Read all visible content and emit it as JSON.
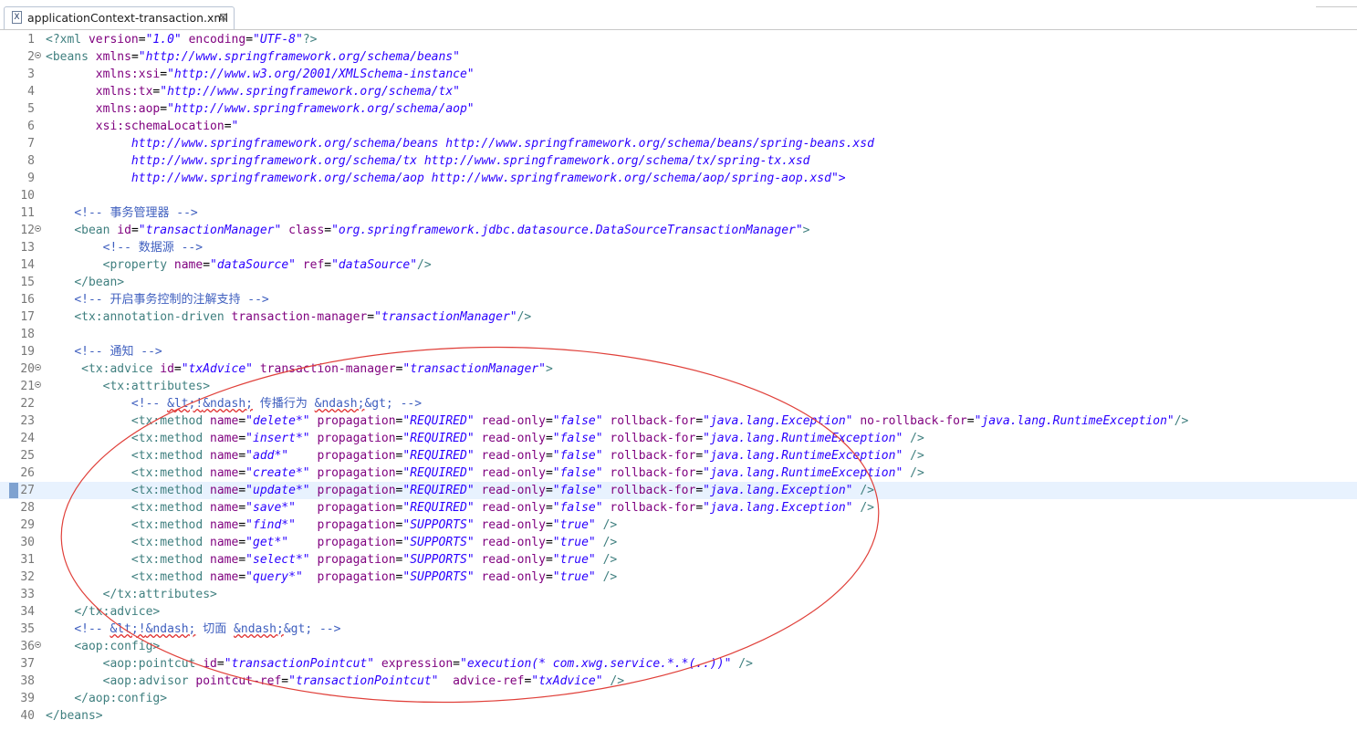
{
  "tab": {
    "icon": "xml-file-icon",
    "icon_glyph": "X",
    "title": "applicationContext-transaction.xml",
    "close_glyph": "⊠"
  },
  "editor": {
    "current_line": 27,
    "lines": [
      {
        "n": "1",
        "code": "<?xml version=\"1.0\" encoding=\"UTF-8\"?>"
      },
      {
        "n": "2",
        "code": "<beans xmlns=\"http://www.springframework.org/schema/beans\"",
        "fold": true
      },
      {
        "n": "3",
        "code": "       xmlns:xsi=\"http://www.w3.org/2001/XMLSchema-instance\""
      },
      {
        "n": "4",
        "code": "       xmlns:tx=\"http://www.springframework.org/schema/tx\""
      },
      {
        "n": "5",
        "code": "       xmlns:aop=\"http://www.springframework.org/schema/aop\""
      },
      {
        "n": "6",
        "code": "       xsi:schemaLocation=\""
      },
      {
        "n": "7",
        "code": "            http://www.springframework.org/schema/beans http://www.springframework.org/schema/beans/spring-beans.xsd"
      },
      {
        "n": "8",
        "code": "            http://www.springframework.org/schema/tx http://www.springframework.org/schema/tx/spring-tx.xsd"
      },
      {
        "n": "9",
        "code": "            http://www.springframework.org/schema/aop http://www.springframework.org/schema/aop/spring-aop.xsd\">"
      },
      {
        "n": "10",
        "code": ""
      },
      {
        "n": "11",
        "code": "    <!-- 事务管理器 -->"
      },
      {
        "n": "12",
        "code": "    <bean id=\"transactionManager\" class=\"org.springframework.jdbc.datasource.DataSourceTransactionManager\">",
        "fold": true
      },
      {
        "n": "13",
        "code": "        <!-- 数据源 -->"
      },
      {
        "n": "14",
        "code": "        <property name=\"dataSource\" ref=\"dataSource\"/>"
      },
      {
        "n": "15",
        "code": "    </bean>"
      },
      {
        "n": "16",
        "code": "    <!-- 开启事务控制的注解支持 -->"
      },
      {
        "n": "17",
        "code": "    <tx:annotation-driven transaction-manager=\"transactionManager\"/>"
      },
      {
        "n": "18",
        "code": ""
      },
      {
        "n": "19",
        "code": "    <!-- 通知 -->"
      },
      {
        "n": "20",
        "code": "     <tx:advice id=\"txAdvice\" transaction-manager=\"transactionManager\">",
        "fold": true
      },
      {
        "n": "21",
        "code": "        <tx:attributes>",
        "fold": true
      },
      {
        "n": "22",
        "code": "            <!-- &lt;!&ndash; 传播行为 &ndash;&gt; -->"
      },
      {
        "n": "23",
        "code": "            <tx:method name=\"delete*\" propagation=\"REQUIRED\" read-only=\"false\" rollback-for=\"java.lang.Exception\" no-rollback-for=\"java.lang.RuntimeException\"/>"
      },
      {
        "n": "24",
        "code": "            <tx:method name=\"insert*\" propagation=\"REQUIRED\" read-only=\"false\" rollback-for=\"java.lang.RuntimeException\" />"
      },
      {
        "n": "25",
        "code": "            <tx:method name=\"add*\"    propagation=\"REQUIRED\" read-only=\"false\" rollback-for=\"java.lang.RuntimeException\" />"
      },
      {
        "n": "26",
        "code": "            <tx:method name=\"create*\" propagation=\"REQUIRED\" read-only=\"false\" rollback-for=\"java.lang.RuntimeException\" />"
      },
      {
        "n": "27",
        "code": "            <tx:method name=\"update*\" propagation=\"REQUIRED\" read-only=\"false\" rollback-for=\"java.lang.Exception\" />"
      },
      {
        "n": "28",
        "code": "            <tx:method name=\"save*\"   propagation=\"REQUIRED\" read-only=\"false\" rollback-for=\"java.lang.Exception\" />"
      },
      {
        "n": "29",
        "code": "            <tx:method name=\"find*\"   propagation=\"SUPPORTS\" read-only=\"true\" />"
      },
      {
        "n": "30",
        "code": "            <tx:method name=\"get*\"    propagation=\"SUPPORTS\" read-only=\"true\" />"
      },
      {
        "n": "31",
        "code": "            <tx:method name=\"select*\" propagation=\"SUPPORTS\" read-only=\"true\" />"
      },
      {
        "n": "32",
        "code": "            <tx:method name=\"query*\"  propagation=\"SUPPORTS\" read-only=\"true\" />"
      },
      {
        "n": "33",
        "code": "        </tx:attributes>"
      },
      {
        "n": "34",
        "code": "    </tx:advice>"
      },
      {
        "n": "35",
        "code": "    <!-- &lt;!&ndash; 切面 &ndash;&gt; -->"
      },
      {
        "n": "36",
        "code": "    <aop:config>",
        "fold": true
      },
      {
        "n": "37",
        "code": "        <aop:pointcut id=\"transactionPointcut\" expression=\"execution(* com.xwg.service.*.*(..))\" />"
      },
      {
        "n": "38",
        "code": "        <aop:advisor pointcut-ref=\"transactionPointcut\"  advice-ref=\"txAdvice\" />"
      },
      {
        "n": "39",
        "code": "    </aop:config>"
      },
      {
        "n": "40",
        "code": "</beans>"
      }
    ]
  },
  "colors": {
    "tag": "#3f7f7f",
    "attribute": "#7f007f",
    "value": "#2a00ff",
    "comment": "#3f5fbf",
    "annotation_ellipse": "#e0403a",
    "current_line": "#e8f2fe"
  }
}
